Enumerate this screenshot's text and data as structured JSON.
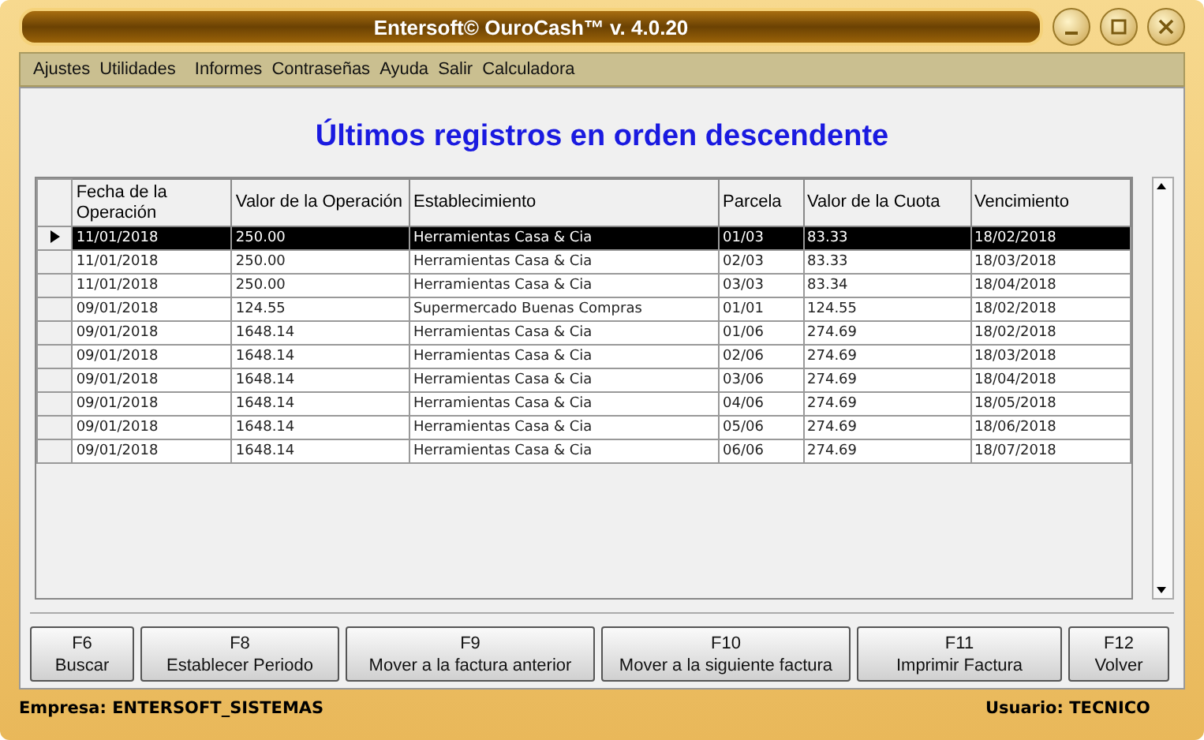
{
  "window": {
    "title": "Entersoft© OuroCash™ v. 4.0.20"
  },
  "menu": [
    "Ajustes",
    "Utilidades",
    "Informes",
    "Contraseñas",
    "Ayuda",
    "Salir",
    "Calculadora"
  ],
  "heading": "Últimos registros en orden descendente",
  "table": {
    "columns": [
      "Fecha de la Operación",
      "Valor de la Operación",
      "Establecimiento",
      "Parcela",
      "Valor de la Cuota",
      "Vencimiento"
    ],
    "rows": [
      {
        "selected": true,
        "cells": [
          "11/01/2018",
          "250.00",
          "Herramientas Casa & Cia",
          "01/03",
          "83.33",
          "18/02/2018"
        ]
      },
      {
        "selected": false,
        "cells": [
          "11/01/2018",
          "250.00",
          "Herramientas Casa & Cia",
          "02/03",
          "83.33",
          "18/03/2018"
        ]
      },
      {
        "selected": false,
        "cells": [
          "11/01/2018",
          "250.00",
          "Herramientas Casa & Cia",
          "03/03",
          "83.34",
          "18/04/2018"
        ]
      },
      {
        "selected": false,
        "cells": [
          "09/01/2018",
          "124.55",
          "Supermercado Buenas Compras",
          "01/01",
          "124.55",
          "18/02/2018"
        ]
      },
      {
        "selected": false,
        "cells": [
          "09/01/2018",
          "1648.14",
          "Herramientas Casa & Cia",
          "01/06",
          "274.69",
          "18/02/2018"
        ]
      },
      {
        "selected": false,
        "cells": [
          "09/01/2018",
          "1648.14",
          "Herramientas Casa & Cia",
          "02/06",
          "274.69",
          "18/03/2018"
        ]
      },
      {
        "selected": false,
        "cells": [
          "09/01/2018",
          "1648.14",
          "Herramientas Casa & Cia",
          "03/06",
          "274.69",
          "18/04/2018"
        ]
      },
      {
        "selected": false,
        "cells": [
          "09/01/2018",
          "1648.14",
          "Herramientas Casa & Cia",
          "04/06",
          "274.69",
          "18/05/2018"
        ]
      },
      {
        "selected": false,
        "cells": [
          "09/01/2018",
          "1648.14",
          "Herramientas Casa & Cia",
          "05/06",
          "274.69",
          "18/06/2018"
        ]
      },
      {
        "selected": false,
        "cells": [
          "09/01/2018",
          "1648.14",
          "Herramientas Casa & Cia",
          "06/06",
          "274.69",
          "18/07/2018"
        ]
      }
    ]
  },
  "buttons": [
    {
      "key": "F6",
      "label": "Buscar"
    },
    {
      "key": "F8",
      "label": "Establecer Periodo"
    },
    {
      "key": "F9",
      "label": "Mover a la factura anterior"
    },
    {
      "key": "F10",
      "label": "Mover a la siguiente factura"
    },
    {
      "key": "F11",
      "label": "Imprimir Factura"
    },
    {
      "key": "F12",
      "label": "Volver"
    }
  ],
  "status_bar": {
    "company": "Empresa: ENTERSOFT_SISTEMAS",
    "user": "Usuario: TECNICO"
  }
}
